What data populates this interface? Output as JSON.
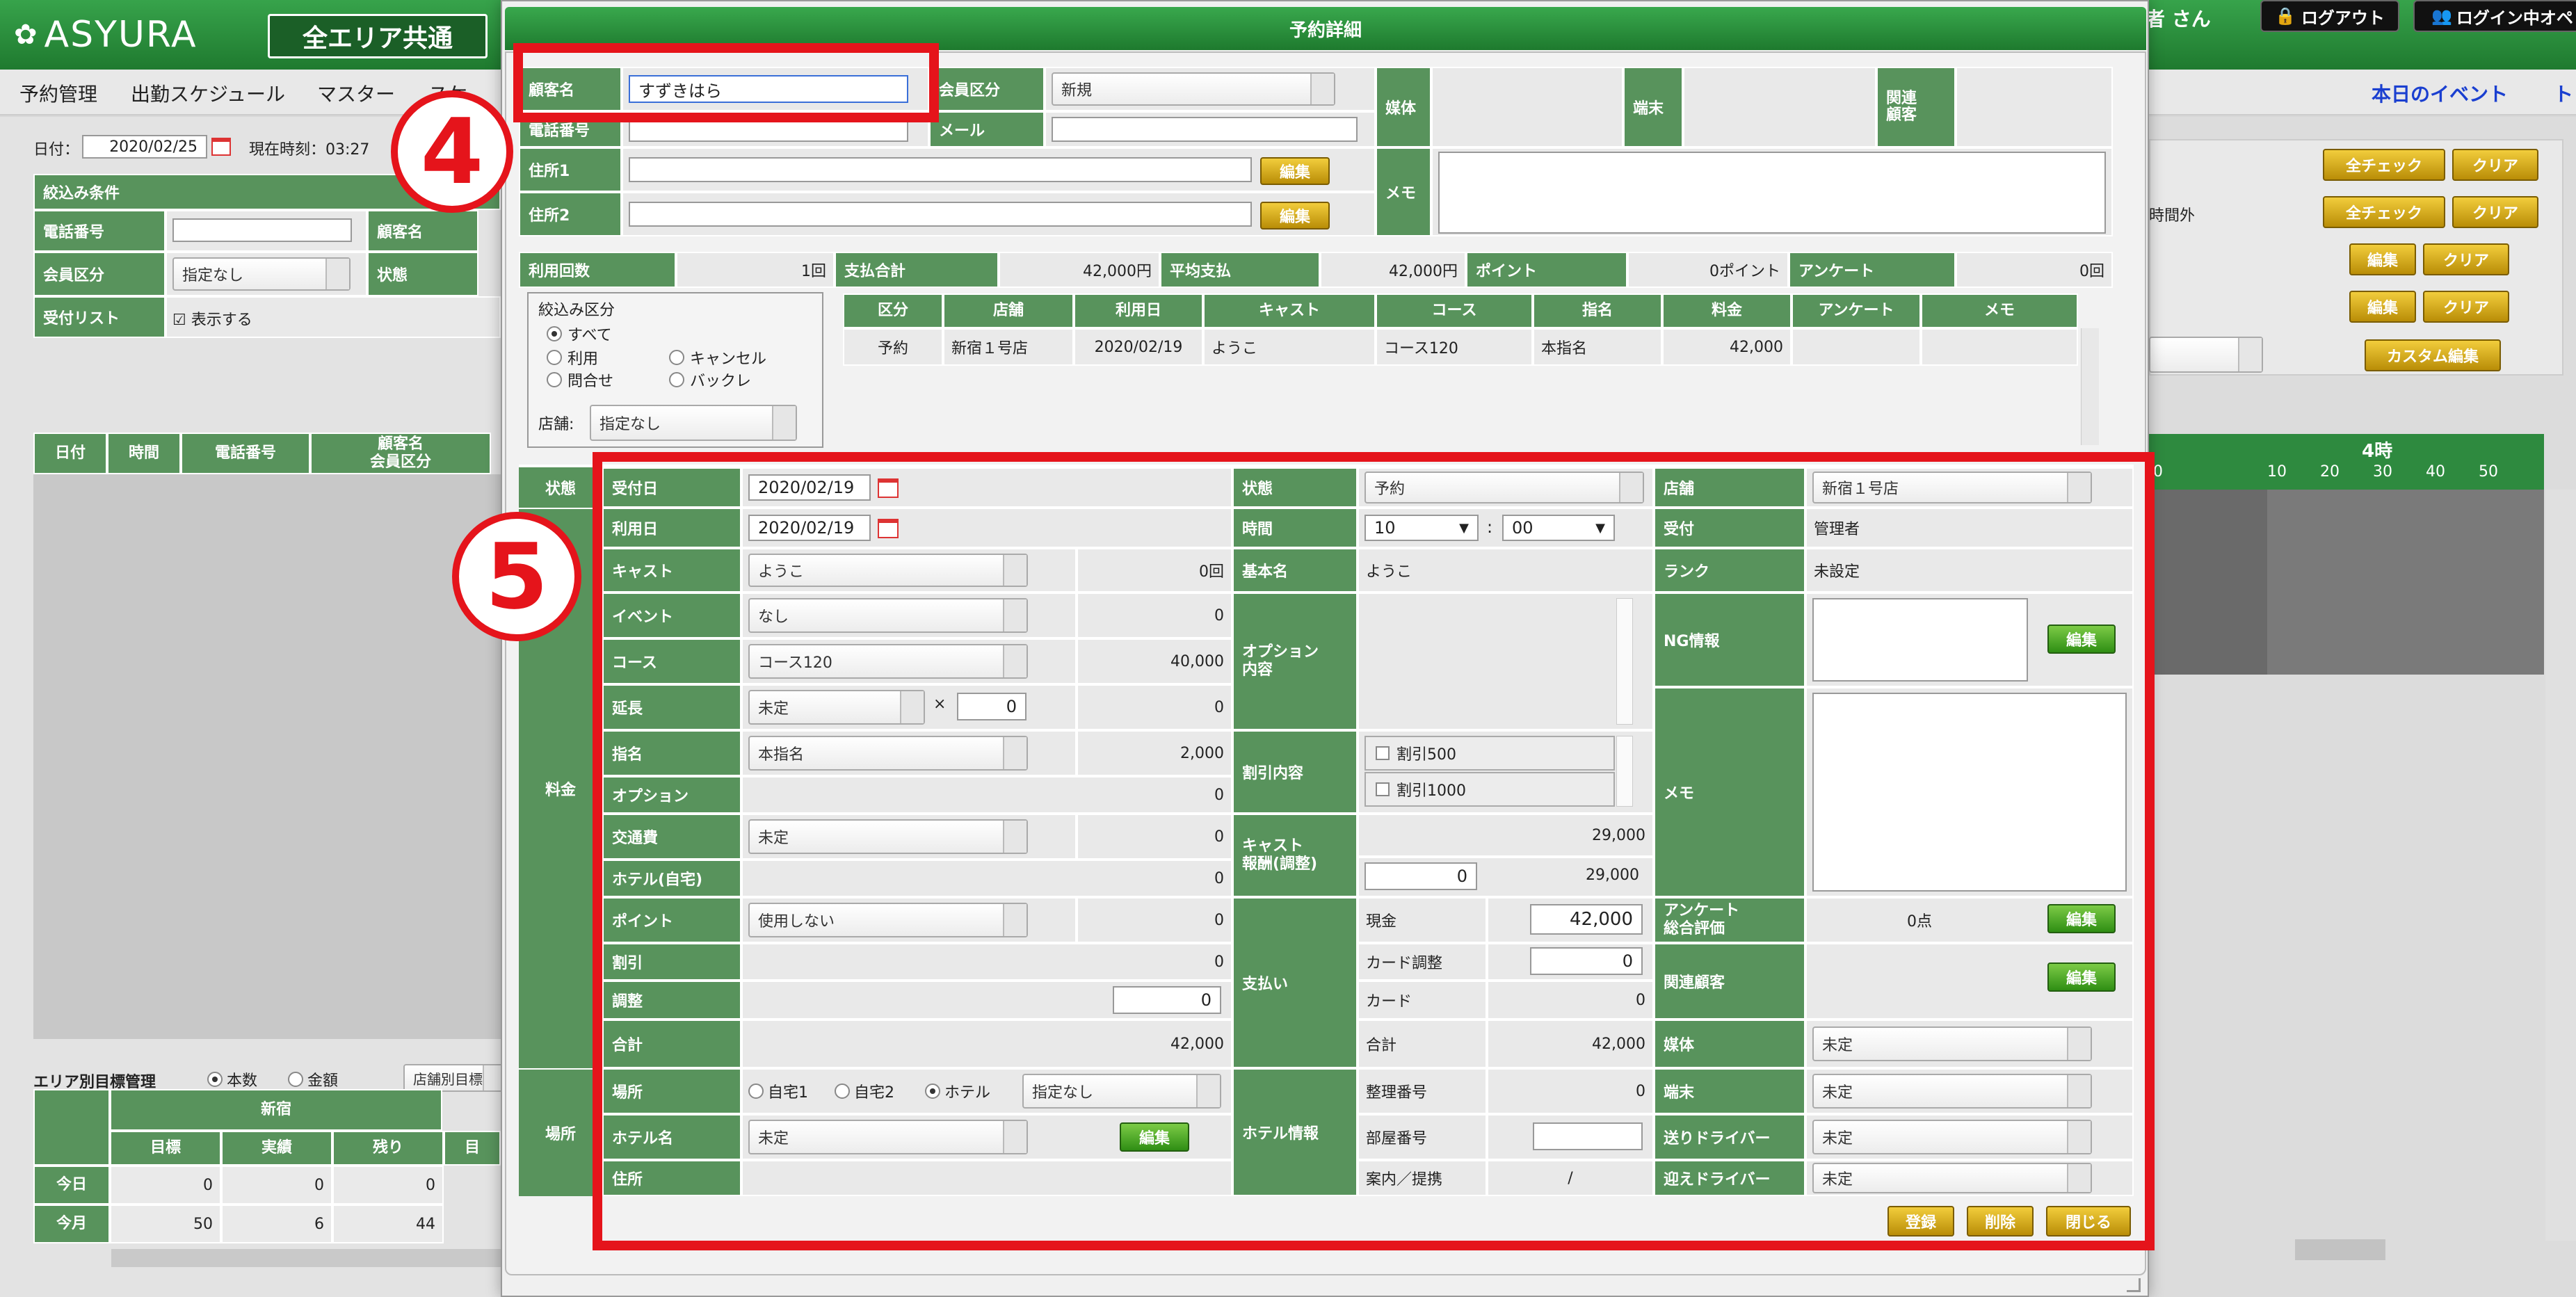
{
  "app": {
    "logo": "ASYURA",
    "area_button": "全エリア共通",
    "user": "者 さん",
    "logout": "ログアウト",
    "login_status": "ログイン中オペレ"
  },
  "nav": {
    "items": [
      "予約管理",
      "出勤スケジュール",
      "マスター",
      "スケ"
    ],
    "event": "本日のイベント",
    "right_cut": "ト"
  },
  "left": {
    "date_label": "日付：",
    "date": "2020/02/25",
    "time": "現在時刻：03:27",
    "filter_title": "絞込み条件",
    "phone": "電話番号",
    "name": "顧客名",
    "member_type": "会員区分",
    "member_select": "指定なし",
    "status": "状態",
    "accept_list": "受付リスト",
    "show": "表示する",
    "table_headers": [
      "日付",
      "時間",
      "電話番号",
      "顧客名\n会員区分"
    ],
    "target_title": "エリア別目標管理",
    "radio_count": "本数",
    "radio_amount": "金額",
    "store_select": "店舗別目標",
    "area": "新宿",
    "cols": [
      "目標",
      "実績",
      "残り",
      "目"
    ],
    "rows": [
      {
        "label": "今日",
        "values": [
          "0",
          "0",
          "0"
        ]
      },
      {
        "label": "今月",
        "values": [
          "50",
          "6",
          "44"
        ]
      }
    ]
  },
  "right": {
    "check_all": "全チェック",
    "clear": "クリア",
    "outside": "時間外",
    "edit": "編集",
    "custom_edit": "カスタム編集",
    "hour": "4時",
    "minutes": [
      "0",
      "10",
      "20",
      "30",
      "40",
      "50"
    ]
  },
  "modal": {
    "title": "予約詳細",
    "customer": {
      "name_label": "顧客名",
      "name_value": "すずきはら",
      "member_label": "会員区分",
      "member_value": "新規",
      "media": "媒体",
      "terminal": "端末",
      "related": "関連\n顧客",
      "phone": "電話番号",
      "mail": "メール",
      "addr1": "住所1",
      "addr2": "住所2",
      "edit": "編集",
      "memo": "メモ"
    },
    "stats": {
      "use_count_label": "利用回数",
      "use_count": "1回",
      "pay_total_label": "支払合計",
      "pay_total": "42,000円",
      "avg_label": "平均支払",
      "avg": "42,000円",
      "point_label": "ポイント",
      "point": "0ポイント",
      "survey_label": "アンケート",
      "survey": "0回"
    },
    "filter": {
      "title": "絞込み区分",
      "all": "すべて",
      "use": "利用",
      "cancel": "キャンセル",
      "inquiry": "問合せ",
      "backcle": "バックレ",
      "store_label": "店舗:",
      "store_value": "指定なし"
    },
    "history": {
      "headers": [
        "区分",
        "店舗",
        "利用日",
        "キャスト",
        "コース",
        "指名",
        "料金",
        "アンケート",
        "メモ"
      ],
      "row": [
        "予約",
        "新宿１号店",
        "2020/02/19",
        "ようこ",
        "コース120",
        "本指名",
        "42,000",
        "",
        ""
      ]
    },
    "section": {
      "state": "状態",
      "fee": "料金",
      "place": "場所"
    },
    "c1": {
      "receipt_date_label": "受付日",
      "receipt_date": "2020/02/19",
      "use_date_label": "利用日",
      "use_date": "2020/02/19",
      "cast_label": "キャスト",
      "cast": "ようこ",
      "cast_cnt": "0回",
      "event_label": "イベント",
      "event": "なし",
      "event_val": "0",
      "course_label": "コース",
      "course": "コース120",
      "course_val": "40,000",
      "ext_label": "延長",
      "ext": "未定",
      "times": "×",
      "ext_n": "0",
      "ext_val": "0",
      "nom_label": "指名",
      "nom": "本指名",
      "nom_val": "2,000",
      "opt_label": "オプション",
      "opt_val": "0",
      "trans_label": "交通費",
      "trans": "未定",
      "trans_val": "0",
      "hotel_home_label": "ホテル(自宅)",
      "hotel_home_val": "0",
      "point_label": "ポイント",
      "point": "使用しない",
      "point_val": "0",
      "disc_label": "割引",
      "disc_val": "0",
      "adj_label": "調整",
      "adj_val": "0",
      "total_label": "合計",
      "total_val": "42,000",
      "place_label": "場所",
      "home1": "自宅1",
      "home2": "自宅2",
      "hotel": "ホテル",
      "place_sel": "指定なし",
      "hotel_name_label": "ホテル名",
      "hotel_name": "未定",
      "edit": "編集",
      "address_label": "住所"
    },
    "c2": {
      "state_label": "状態",
      "state": "予約",
      "time_label": "時間",
      "hour": "10",
      "colon": ":",
      "minute": "00",
      "basename_label": "基本名",
      "basename": "ようこ",
      "option_label": "オプション\n内容",
      "discount_label": "割引内容",
      "disc1": "割引500",
      "disc2": "割引1000",
      "cast_pay_label": "キャスト\n報酬(調整)",
      "cast_pay1": "29,000",
      "cast_pay_adj": "0",
      "cast_pay2": "29,000",
      "pay_label": "支払い",
      "cash_label": "現金",
      "cash": "42,000",
      "card_adj_label": "カード調整",
      "card_adj": "0",
      "card_label": "カード",
      "card": "0",
      "total_label": "合計",
      "total": "42,000",
      "hotel_info_label": "ホテル情報",
      "ref_no_label": "整理番号",
      "ref_no": "0",
      "room_label": "部屋番号",
      "guide_label": "案内／提携",
      "guide": "/"
    },
    "c3": {
      "store_label": "店舗",
      "store": "新宿１号店",
      "receipt_label": "受付",
      "receipt": "管理者",
      "rank_label": "ランク",
      "rank": "未設定",
      "ng_label": "NG情報",
      "edit": "編集",
      "memo_label": "メモ",
      "survey_label": "アンケート\n総合評価",
      "survey": "0点",
      "related_label": "関連顧客",
      "media_label": "媒体",
      "media": "未定",
      "terminal_label": "端末",
      "terminal": "未定",
      "send_label": "送りドライバー",
      "send": "未定",
      "pick_label": "迎えドライバー",
      "pick": "未定"
    },
    "actions": {
      "register": "登録",
      "delete": "削除",
      "close": "閉じる"
    }
  },
  "annotations": {
    "n4": "4",
    "n5": "5"
  },
  "colors": {
    "green": "#58935c",
    "dark_green": "#2e8a3f",
    "red": "#e5141b",
    "gold": "#d3a815"
  }
}
